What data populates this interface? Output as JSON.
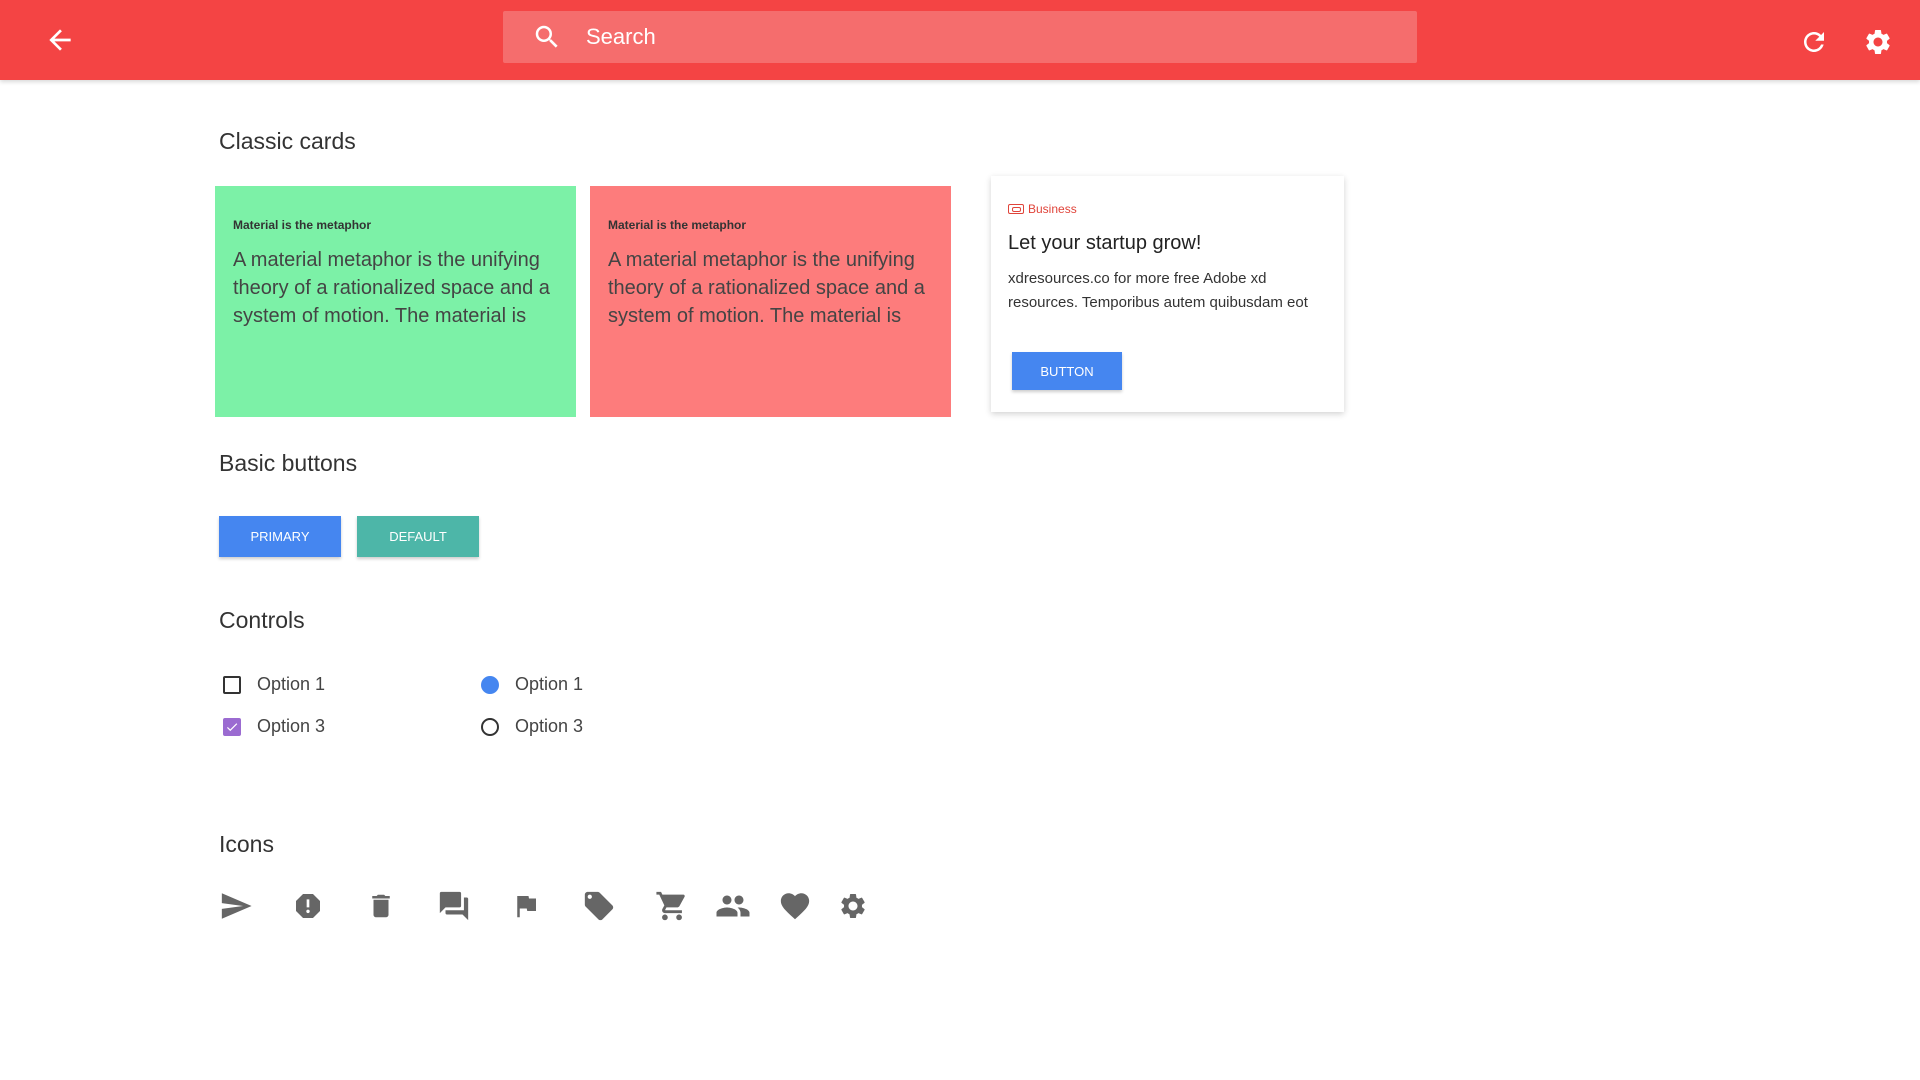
{
  "header": {
    "search_placeholder": "Search",
    "icons": {
      "back": "arrow-back-icon",
      "search": "search-icon",
      "refresh": "refresh-icon",
      "settings": "gear-icon"
    },
    "colors": {
      "bar": "#f44444",
      "search_bg": "#f56d6d"
    }
  },
  "sections": {
    "classic_cards": "Classic cards",
    "basic_buttons": "Basic buttons",
    "controls": "Controls",
    "icons": "Icons"
  },
  "cards": {
    "green": {
      "label": "Material is the metaphor",
      "body": "A material metaphor is the unifying theory of a rationalized space and a system of motion. The material is",
      "color": "#7cf1a7"
    },
    "red": {
      "label": "Material is the metaphor",
      "body": "A material metaphor is the unifying theory of a rationalized space and a system of motion. The material is",
      "color": "#fd7c7c"
    },
    "white": {
      "badge": "Business",
      "headline": "Let your startup grow!",
      "description": "xdresources.co for more free Adobe xd resources. Temporibus autem quibusdam eot",
      "button": "BUTTON"
    }
  },
  "buttons": {
    "primary": "PRIMARY",
    "default": "DEFAULT",
    "colors": {
      "primary": "#4586f0",
      "default": "#4db6a8"
    }
  },
  "controls": {
    "checkboxes": [
      {
        "label": "Option 1",
        "checked": false
      },
      {
        "label": "Option 3",
        "checked": true
      }
    ],
    "radios": [
      {
        "label": "Option 1",
        "checked": true
      },
      {
        "label": "Option 3",
        "checked": false
      }
    ],
    "colors": {
      "checkbox_checked": "#9b6bd1",
      "radio_checked": "#4586f0"
    }
  },
  "icons_row": [
    "send-icon",
    "alert-icon",
    "trash-icon",
    "chat-icon",
    "flag-icon",
    "tag-icon",
    "cart-icon",
    "people-icon",
    "heart-icon",
    "gear-icon"
  ]
}
